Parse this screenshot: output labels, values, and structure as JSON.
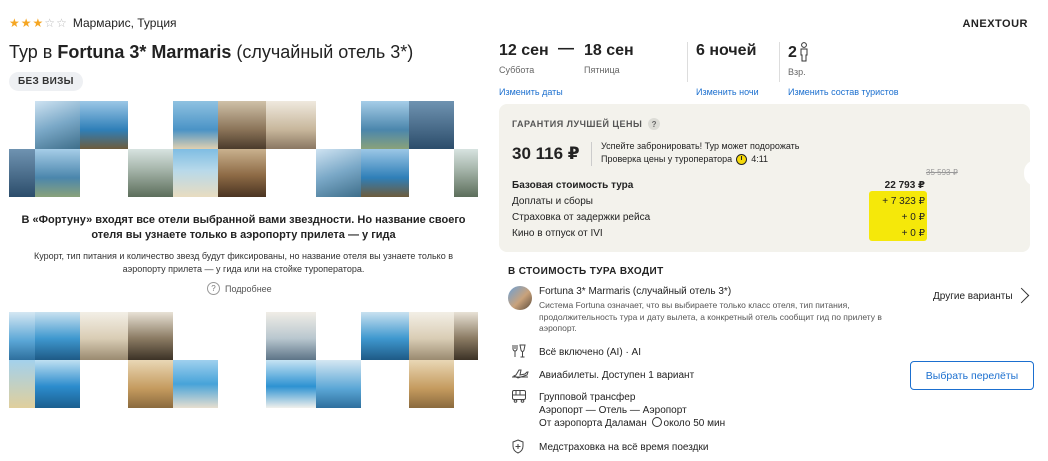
{
  "header": {
    "stars_filled": 3,
    "stars_total": 5,
    "location": "Мармарис, Турция",
    "operator": "ANEXTOUR",
    "title_prefix": "Тур в ",
    "title_bold": "Fortuna 3* Marmaris",
    "title_suffix": " (случайный отель 3*)",
    "badge": "БЕЗ ВИЗЫ"
  },
  "fortuna": {
    "headline": "В «Фортуну» входят все отели выбранной вами звездности. Но название своего отеля вы узнаете только в аэропорту прилета — у гида",
    "sub": "Курорт, тип питания и количество звезд будут фиксированы, но название отеля вы узнаете только в аэропорту прилета — у гида или на стойке туроператора.",
    "more": "Подробнее"
  },
  "trip": {
    "date_from": "12 сен",
    "day_from": "Суббота",
    "date_to": "18 сен",
    "day_to": "Пятница",
    "nights": "6 ночей",
    "tourists": "2",
    "tourists_label": "Взр.",
    "change_dates": "Изменить даты",
    "change_nights": "Изменить ночи",
    "change_tourists": "Изменить состав туристов"
  },
  "price": {
    "guarantee": "ГАРАНТИЯ ЛУЧШЕЙ ЦЕНЫ",
    "total": "30 116 ₽",
    "note_line1": "Успейте забронировать! Тур может подорожать",
    "note_line2": "Проверка цены у туроператора",
    "timer": "4:11",
    "old_price": "35 593 ₽",
    "rows": [
      {
        "label": "Базовая стоимость тура",
        "value": "22 793 ₽"
      },
      {
        "label": "Доплаты и сборы",
        "value": "+ 7 323 ₽"
      },
      {
        "label": "Страховка от задержки рейса",
        "value": "+ 0 ₽"
      },
      {
        "label": "Кино в отпуск от IVI",
        "value": "+ 0 ₽"
      }
    ]
  },
  "included": {
    "title": "В СТОИМОСТЬ ТУРА ВХОДИТ",
    "hotel_name": "Fortuna 3* Marmaris (случайный отель 3*)",
    "hotel_desc": "Система Fortuna означает, что вы выбираете только класс отеля, тип питания, продолжительность тура и дату вылета, а конкретный отель сообщит гид по прилету в аэропорт.",
    "other_variants": "Другие варианты",
    "meal": "Всё включено (AI) · AI",
    "flights": "Авиабилеты. Доступен 1 вариант",
    "flights_button": "Выбрать перелёты",
    "transfer_line1": "Групповой трансфер",
    "transfer_line2": "Аэропорт — Отель — Аэропорт",
    "transfer_line3a": "От аэропорта Даламан",
    "transfer_line3b": "около 50 мин",
    "insurance": "Медстраховка на всё время поездки"
  },
  "colors": {
    "accent_blue": "#1b6fcf",
    "highlight_yellow": "#f5e80a",
    "star": "#f5a623",
    "price_bg": "#f3f2ec"
  }
}
